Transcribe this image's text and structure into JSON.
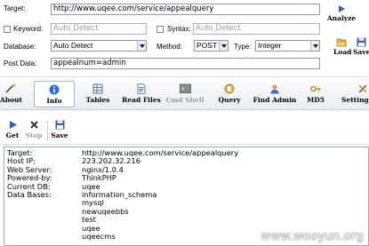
{
  "form": {
    "target_label": "Target:",
    "target_value": "http://www.uqee.com/service/appealquery",
    "keyword_label": "Keyword:",
    "keyword_value": "Auto Detect",
    "syntax_label": "Syntax:",
    "syntax_value": "Auto Detect",
    "database_label": "Database:",
    "database_value": "Auto Detect",
    "method_label": "Method:",
    "method_value": "POST",
    "type_label": "Type:",
    "type_value": "Integer",
    "postdata_label": "Post Data:",
    "postdata_value": "appealnum=admin"
  },
  "side": {
    "analyze_label": "Analyze",
    "load_label": "Load",
    "save_label": "Save"
  },
  "tabs": [
    {
      "label": "About"
    },
    {
      "label": "Info"
    },
    {
      "label": "Tables"
    },
    {
      "label": "Read Files"
    },
    {
      "label": "Cmd Shell"
    },
    {
      "label": "Query"
    },
    {
      "label": "Find Admin"
    },
    {
      "label": "MD5"
    },
    {
      "label": "Setting"
    }
  ],
  "subbar": {
    "get_label": "Get",
    "stop_label": "Stop",
    "save_label": "Save"
  },
  "results": {
    "target_key": "Target:",
    "target_val": "http://www.uqee.com/service/appealquery",
    "host_key": "Host IP:",
    "host_val": "223.202.32.216",
    "server_key": "Web Server:",
    "server_val": "nginx/1.0.4",
    "powered_key": "Powered-by:",
    "powered_val": "ThinkPHP",
    "db_key": "Current DB:",
    "db_val": "uqee",
    "dbs_key": "Data Bases:",
    "databases": [
      "information_schema",
      "mysql",
      "newuqeebbs",
      "test",
      "uqee",
      "uqeecms"
    ]
  },
  "watermark": "www.wooyun.org",
  "colors": {
    "accent": "#1e5eb8",
    "border": "#8c9aab",
    "disabled_text": "#9a9a9a"
  }
}
